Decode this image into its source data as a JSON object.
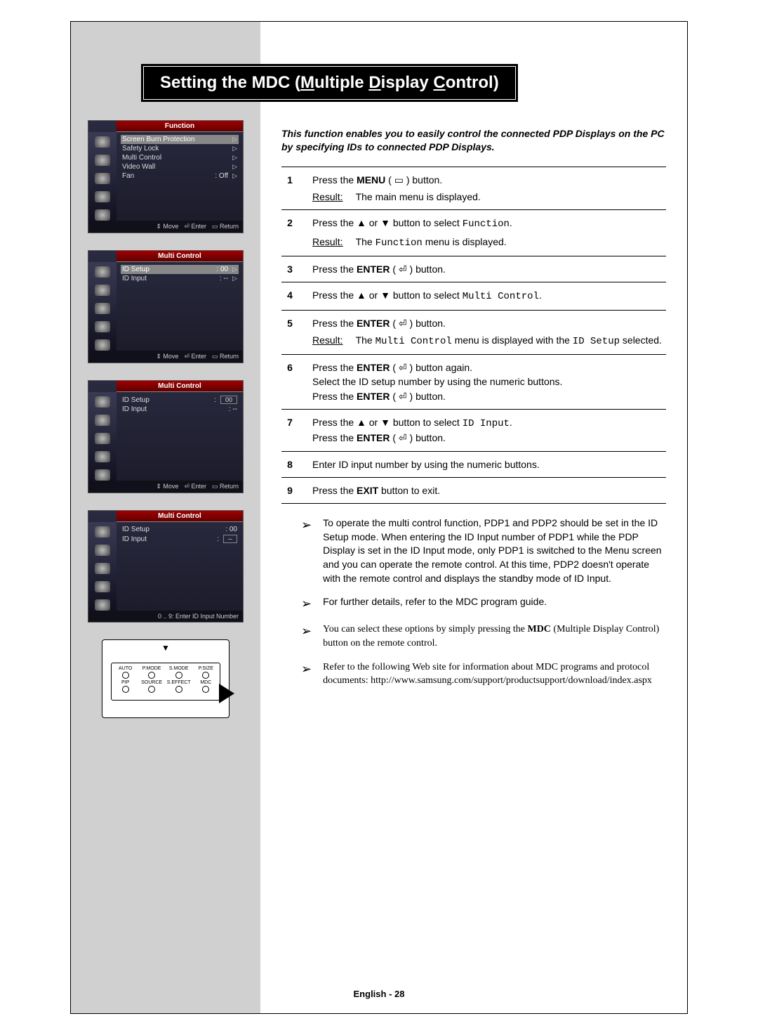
{
  "title": {
    "pre": "Setting the MDC (",
    "m": "M",
    "mid1": "ultiple ",
    "d": "D",
    "mid2": "isplay ",
    "c": "C",
    "post": "ontrol)"
  },
  "intro": "This function enables you to easily control the connected PDP Displays on the PC by specifying IDs to connected PDP Displays.",
  "osd1": {
    "header": "Function",
    "rows": [
      {
        "label": "Screen Burn Protection",
        "val": "",
        "arrow": "▷",
        "sel": true
      },
      {
        "label": "Safety Lock",
        "val": "",
        "arrow": "▷"
      },
      {
        "label": "Multi Control",
        "val": "",
        "arrow": "▷"
      },
      {
        "label": "Video Wall",
        "val": "",
        "arrow": "▷"
      },
      {
        "label": "Fan",
        "val": ": Off",
        "arrow": "▷"
      }
    ],
    "footer": {
      "move": "Move",
      "enter": "Enter",
      "ret": "Return"
    }
  },
  "osd2": {
    "header": "Multi Control",
    "rows": [
      {
        "label": "ID Setup",
        "val": ":   00",
        "arrow": "▷",
        "sel": true
      },
      {
        "label": "ID Input",
        "val": ":   --",
        "arrow": "▷"
      }
    ],
    "footer": {
      "move": "Move",
      "enter": "Enter",
      "ret": "Return"
    }
  },
  "osd3": {
    "header": "Multi Control",
    "rows": [
      {
        "label": "ID Setup",
        "val": ":",
        "box": "00"
      },
      {
        "label": "ID Input",
        "val": ":   --"
      }
    ],
    "footer": {
      "move": "Move",
      "enter": "Enter",
      "ret": "Return"
    }
  },
  "osd4": {
    "header": "Multi Control",
    "rows": [
      {
        "label": "ID Setup",
        "val": ":   00"
      },
      {
        "label": "ID Input",
        "val": ":",
        "box": "--"
      }
    ],
    "footer_alt": "0 .. 9: Enter ID Input Number"
  },
  "remote": {
    "labels": [
      "AUTO",
      "P.MODE",
      "S.MODE",
      "P.SIZE",
      "PIP",
      "SOURCE",
      "S.EFFECT",
      "MDC"
    ]
  },
  "steps": [
    {
      "n": "1",
      "lines": [
        {
          "t": "Press the ",
          "b": "MENU",
          "t2": " ( ▭ ) button."
        }
      ],
      "result": "The main menu is displayed."
    },
    {
      "n": "2",
      "lines": [
        {
          "t": "Press the ▲ or ▼ button to select ",
          "mono": "Function",
          "t2": "."
        }
      ],
      "result_rich": {
        "pre": "The ",
        "mono": "Function",
        "post": " menu is displayed."
      }
    },
    {
      "n": "3",
      "lines": [
        {
          "t": "Press the ",
          "b": "ENTER",
          "t2": " ( ⏎ ) button."
        }
      ]
    },
    {
      "n": "4",
      "lines": [
        {
          "t": "Press the ▲ or ▼ button to select ",
          "mono": "Multi Control",
          "t2": "."
        }
      ]
    },
    {
      "n": "5",
      "lines": [
        {
          "t": "Press the ",
          "b": "ENTER",
          "t2": " ( ⏎ ) button."
        }
      ],
      "result_rich": {
        "pre": "The ",
        "mono": "Multi Control",
        "mid": " menu is displayed with the ",
        "mono2": "ID Setup",
        "post": " selected."
      }
    },
    {
      "n": "6",
      "multiline": "Press the <b>ENTER</b> ( ⏎ ) button again.<br>Select the ID setup number by using the numeric buttons.<br>Press the <b>ENTER</b> ( ⏎ ) button."
    },
    {
      "n": "7",
      "multiline": "Press the ▲ or ▼ button to select <span class='mono'>ID Input</span>.<br>Press the <b>ENTER</b> ( ⏎ ) button."
    },
    {
      "n": "8",
      "plain": "Enter ID input number by using the numeric buttons."
    },
    {
      "n": "9",
      "lines": [
        {
          "t": "Press the ",
          "b": "EXIT",
          "t2": " button to exit."
        }
      ]
    }
  ],
  "notes": [
    {
      "serif": false,
      "text": "To operate the multi control function, PDP1 and PDP2 should be set in the ID Setup mode. When entering the ID Input number of PDP1 while the PDP Display is set in the ID Input mode, only PDP1 is switched to the Menu screen and you can operate the remote control. At this time, PDP2 doesn't operate with the remote control and displays the standby mode of ID Input."
    },
    {
      "serif": false,
      "text": "For further details, refer to the MDC program guide."
    },
    {
      "serif": true,
      "html": "You can select these options by simply pressing the <b>MDC</b> (Multiple Display Control) button on the remote control."
    },
    {
      "serif": true,
      "text": "Refer to the following Web site for information about MDC programs and protocol documents: http://www.samsung.com/support/productsupport/download/index.aspx"
    }
  ],
  "footer": "English - 28",
  "result_label": "Result:"
}
